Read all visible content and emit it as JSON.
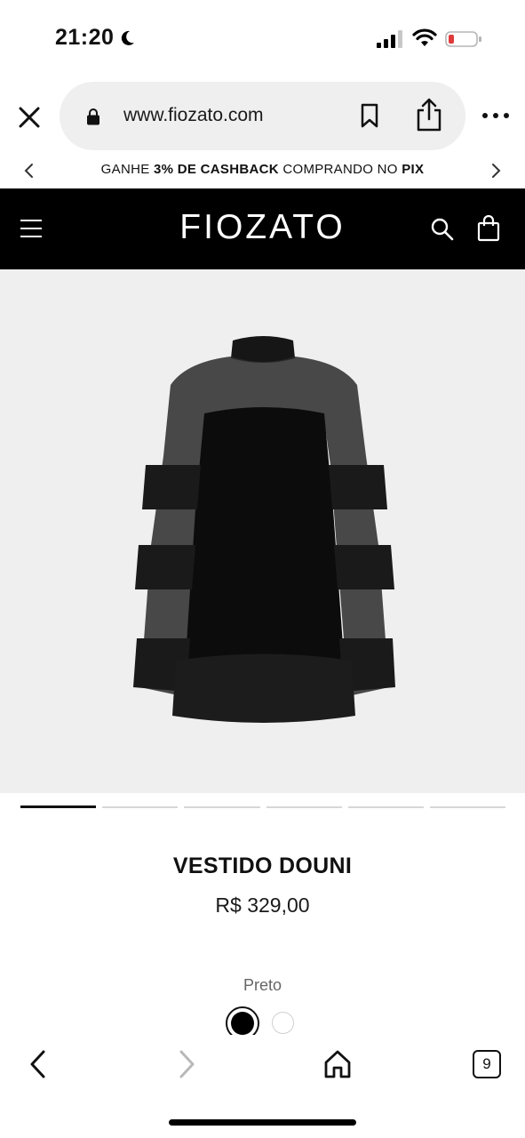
{
  "status_bar": {
    "time": "21:20",
    "icons": [
      "moon-icon",
      "signal-icon",
      "wifi-icon",
      "battery-low-icon"
    ],
    "battery_color": "#e03a3a"
  },
  "browser": {
    "url": "www.fiozato.com",
    "icons": [
      "close-icon",
      "lock-icon",
      "bookmark-icon",
      "share-icon",
      "more-icon"
    ]
  },
  "promo": {
    "text_pre": "GANHE ",
    "text_bold_1": "3% DE CASHBACK",
    "text_mid": " COMPRANDO NO ",
    "text_bold_2": "PIX"
  },
  "header": {
    "logo": "FIOZATO",
    "background": "#000000"
  },
  "product": {
    "name": "VESTIDO DOUNI",
    "price": "R$ 329,00",
    "color_label": "Preto",
    "image_count": 6,
    "active_image": 1,
    "swatches": [
      "black",
      "white"
    ]
  },
  "toolbar": {
    "tab_count": "9",
    "icons": [
      "back-icon",
      "forward-icon",
      "home-icon",
      "tabs-icon"
    ]
  }
}
